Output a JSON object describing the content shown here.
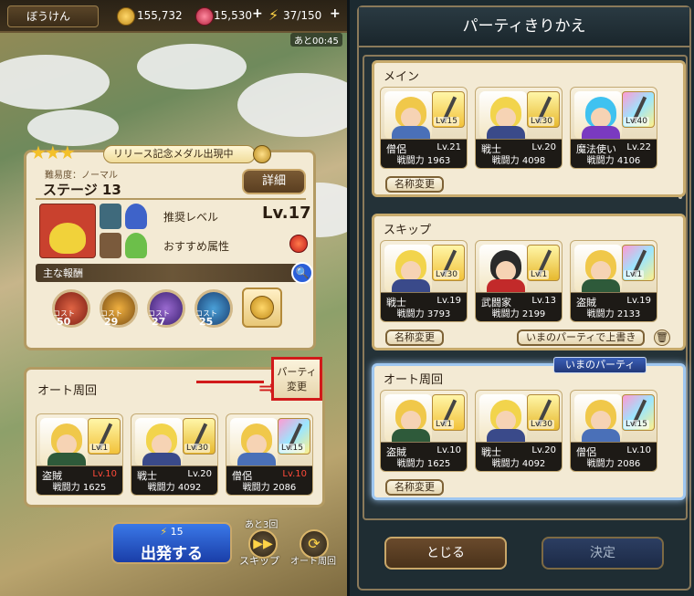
{
  "topbar": {
    "title": "ぼうけん",
    "coins": "155,732",
    "gems": "15,530",
    "gems_plus": "+",
    "stamina": "37/150",
    "stamina_plus": "+",
    "stamina_timer": "あと00:45"
  },
  "stage_card": {
    "banner": "リリース記念メダル出現中",
    "difficulty": "難易度：ノーマル",
    "stage": "ステージ 13",
    "details_button": "詳細",
    "recommended_level_label": "推奨レベル",
    "recommended_level": "Lv.17",
    "recommended_attr_label": "おすすめ属性",
    "rewards_label": "主な報酬",
    "rewards": [
      {
        "cost_label": "コスト",
        "cost": "50"
      },
      {
        "cost_label": "コスト",
        "cost": "29"
      },
      {
        "cost_label": "コスト",
        "cost": "27"
      },
      {
        "cost_label": "コスト",
        "cost": "25"
      }
    ]
  },
  "auto_party": {
    "title": "オート周回",
    "change_button_line1": "パーティ",
    "change_button_line2": "変更",
    "members": [
      {
        "class": "盗賊",
        "level": "Lv.10",
        "level_red": true,
        "power": "戦闘力 1625",
        "weapon_lv": "Lv.1"
      },
      {
        "class": "戦士",
        "level": "Lv.20",
        "level_red": false,
        "power": "戦闘力 4092",
        "weapon_lv": "Lv.30"
      },
      {
        "class": "僧侶",
        "level": "Lv.10",
        "level_red": true,
        "power": "戦闘力 2086",
        "weapon_lv": "Lv.15"
      }
    ]
  },
  "bottom_bar": {
    "start_stamina": "15",
    "start_label": "出発する",
    "remaining": "あと3回",
    "skip_label": "スキップ",
    "auto_label": "オート周回"
  },
  "party_switch": {
    "title": "パーティきりかえ",
    "rename_label": "名称変更",
    "overwrite_label": "いまのパーティで上書き",
    "current_badge": "いまのパーティ",
    "close_button": "とじる",
    "confirm_button": "決定",
    "parties": [
      {
        "name": "メイン",
        "members": [
          {
            "class": "僧侶",
            "level": "Lv.21",
            "power": "戦闘力 1963",
            "weapon_lv": "Lv.15"
          },
          {
            "class": "戦士",
            "level": "Lv.20",
            "power": "戦闘力 4098",
            "weapon_lv": "Lv.30"
          },
          {
            "class": "魔法使い",
            "level": "Lv.22",
            "power": "戦闘力 4106",
            "weapon_lv": "Lv.40"
          }
        ]
      },
      {
        "name": "スキップ",
        "members": [
          {
            "class": "戦士",
            "level": "Lv.19",
            "power": "戦闘力 3793",
            "weapon_lv": "Lv.30"
          },
          {
            "class": "武闘家",
            "level": "Lv.13",
            "power": "戦闘力 2199",
            "weapon_lv": "Lv.1"
          },
          {
            "class": "盗賊",
            "level": "Lv.19",
            "power": "戦闘力 2133",
            "weapon_lv": "Lv.1"
          }
        ]
      },
      {
        "name": "オート周回",
        "members": [
          {
            "class": "盗賊",
            "level": "Lv.10",
            "power": "戦闘力 1625",
            "weapon_lv": "Lv.1"
          },
          {
            "class": "戦士",
            "level": "Lv.20",
            "power": "戦闘力 4092",
            "weapon_lv": "Lv.30"
          },
          {
            "class": "僧侶",
            "level": "Lv.10",
            "power": "戦闘力 2086",
            "weapon_lv": "Lv.15"
          }
        ]
      }
    ]
  }
}
